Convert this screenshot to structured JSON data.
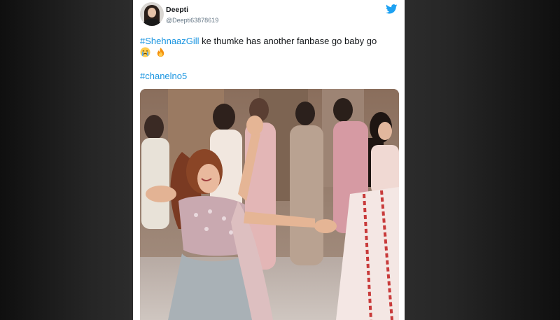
{
  "tweet": {
    "display_name": "Deepti",
    "handle": "@Deepti63878619",
    "hashtag_1": "#ShehnaazGill",
    "text_rest": " ke thumke has another fanbase go baby go",
    "emojis": [
      "crying-face-emoji",
      "fire-emoji"
    ],
    "hashtag_2": "#chanelno5"
  },
  "colors": {
    "link": "#1b95e0",
    "twitter_brand": "#1da1f2",
    "text": "#14171a",
    "muted": "#657786"
  },
  "icons": {
    "brand": "twitter-bird-icon"
  }
}
